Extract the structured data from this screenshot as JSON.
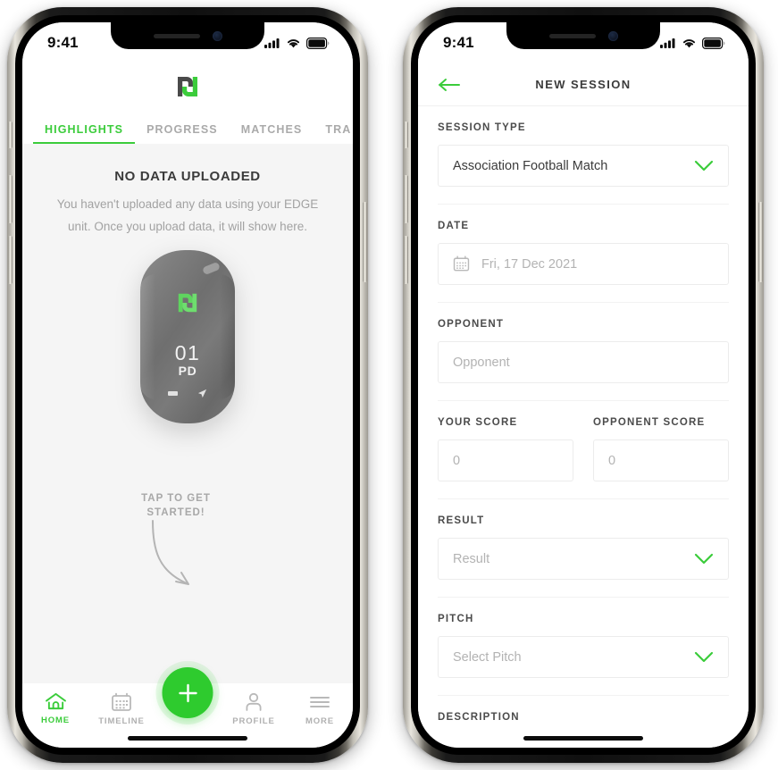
{
  "theme": {
    "brand_green": "#3BCC3B",
    "fab_green": "#2ECB2E",
    "text_dark": "#3B3B3B",
    "text_muted": "#A2A2A2",
    "screen_bg": "#F5F5F5"
  },
  "left_phone": {
    "status_bar": {
      "time": "9:41",
      "icons": [
        "cellular-signal-icon",
        "wifi-icon",
        "battery-icon"
      ]
    },
    "logo": {
      "name": "pd-brand-logo"
    },
    "tabs": [
      {
        "label": "HIGHLIGHTS",
        "active": true
      },
      {
        "label": "PROGRESS",
        "active": false
      },
      {
        "label": "MATCHES",
        "active": false
      },
      {
        "label": "TRA",
        "active": false
      }
    ],
    "empty_state": {
      "title": "NO DATA UPLOADED",
      "description": "You haven't uploaded any data using your EDGE unit. Once you upload data, it will show here."
    },
    "edge_device": {
      "name": "edge-unit-illustration",
      "screen_number": "01",
      "screen_label": "PD",
      "status_icons": [
        "battery-icon",
        "gps-location-icon"
      ]
    },
    "tap_hint": "TAP TO GET STARTED!",
    "fab": {
      "label": "+",
      "name": "add-session-fab"
    },
    "bottom_nav": [
      {
        "label": "HOME",
        "icon": "home-icon",
        "active": true
      },
      {
        "label": "TIMELINE",
        "icon": "calendar-icon",
        "active": false
      },
      {
        "label": "PROFILE",
        "icon": "person-icon",
        "active": false
      },
      {
        "label": "MORE",
        "icon": "hamburger-menu-icon",
        "active": false
      }
    ]
  },
  "right_phone": {
    "status_bar": {
      "time": "9:41",
      "icons": [
        "cellular-signal-icon",
        "wifi-icon",
        "battery-icon"
      ]
    },
    "header": {
      "back_icon": "back-arrow-icon",
      "title": "NEW SESSION"
    },
    "fields": {
      "session_type": {
        "label": "SESSION TYPE",
        "value": "Association Football Match",
        "control": "dropdown"
      },
      "date": {
        "label": "DATE",
        "value": "Fri, 17 Dec 2021",
        "icon": "calendar-icon",
        "control": "date-picker"
      },
      "opponent": {
        "label": "OPPONENT",
        "placeholder": "Opponent",
        "value": "",
        "control": "text-input"
      },
      "your_score": {
        "label": "YOUR SCORE",
        "placeholder": "0",
        "value": "",
        "control": "number-input"
      },
      "opponent_score": {
        "label": "OPPONENT SCORE",
        "placeholder": "0",
        "value": "",
        "control": "number-input"
      },
      "result": {
        "label": "RESULT",
        "placeholder": "Result",
        "value": "",
        "control": "dropdown"
      },
      "pitch": {
        "label": "PITCH",
        "placeholder": "Select Pitch",
        "value": "",
        "control": "dropdown"
      },
      "description": {
        "label": "DESCRIPTION"
      }
    }
  }
}
